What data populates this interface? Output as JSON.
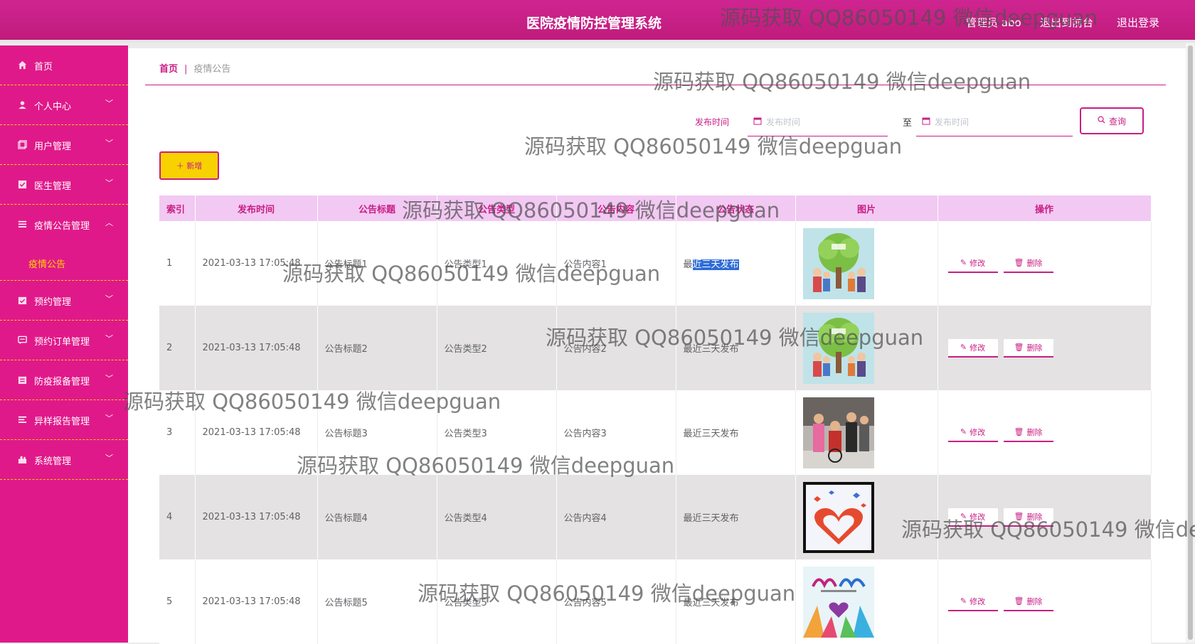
{
  "header": {
    "title": "医院疫情防控管理系统",
    "user": "管理员 abo",
    "front_link": "退出到前台",
    "logout_link": "退出登录"
  },
  "sidebar": {
    "items": [
      {
        "label": "首页",
        "icon": "home-icon"
      },
      {
        "label": "个人中心",
        "icon": "user-icon"
      },
      {
        "label": "用户管理",
        "icon": "users-icon"
      },
      {
        "label": "医生管理",
        "icon": "doctor-icon"
      },
      {
        "label": "疫情公告管理",
        "icon": "list-icon",
        "expanded": true,
        "sub": "疫情公告"
      },
      {
        "label": "预约管理",
        "icon": "calendar-icon"
      },
      {
        "label": "预约订单管理",
        "icon": "order-icon"
      },
      {
        "label": "防疫报备管理",
        "icon": "report-icon"
      },
      {
        "label": "异样报告管理",
        "icon": "warning-list-icon"
      },
      {
        "label": "系统管理",
        "icon": "settings-icon"
      }
    ],
    "active_sub": "疫情公告"
  },
  "breadcrumb": {
    "home": "首页",
    "separator": "|",
    "current": "疫情公告"
  },
  "search": {
    "label": "发布时间",
    "start_placeholder": "发布时间",
    "to_label": "至",
    "end_placeholder": "发布时间",
    "query_button": "查询"
  },
  "toolbar": {
    "add_button": "＋ 新增"
  },
  "table": {
    "headers": [
      "索引",
      "发布时间",
      "公告标题",
      "公告类型",
      "公告内容",
      "公告状态",
      "图片",
      "操作"
    ],
    "rows": [
      {
        "index": "1",
        "time": "2021-03-13 17:05:48",
        "title": "公告标题1",
        "type": "公告类型1",
        "content": "公告内容1",
        "status_prefix": "最",
        "status_selected": "近三天发布",
        "image": "tree-family-illustration"
      },
      {
        "index": "2",
        "time": "2021-03-13 17:05:48",
        "title": "公告标题2",
        "type": "公告类型2",
        "content": "公告内容2",
        "status": "最近三天发布",
        "image": "tree-family-illustration"
      },
      {
        "index": "3",
        "time": "2021-03-13 17:05:48",
        "title": "公告标题3",
        "type": "公告类型3",
        "content": "公告内容3",
        "status": "最近三天发布",
        "image": "people-photo"
      },
      {
        "index": "4",
        "time": "2021-03-13 17:05:48",
        "title": "公告标题4",
        "type": "公告类型4",
        "content": "公告内容4",
        "status": "最近三天发布",
        "image": "heart-hands-illustration"
      },
      {
        "index": "5",
        "time": "2021-03-13 17:05:48",
        "title": "公告标题5",
        "type": "公告类型5",
        "content": "公告内容5",
        "status": "最近三天发布",
        "image": "love-poster-illustration"
      }
    ],
    "edit_label": "修改",
    "delete_label": "删除"
  },
  "watermark": "源码获取 QQ86050149 微信deepguan",
  "colors": {
    "brand": "#c81e84",
    "sidebar": "#e0198a",
    "accent": "#f7d100",
    "header_row": "#f2c9f2"
  }
}
